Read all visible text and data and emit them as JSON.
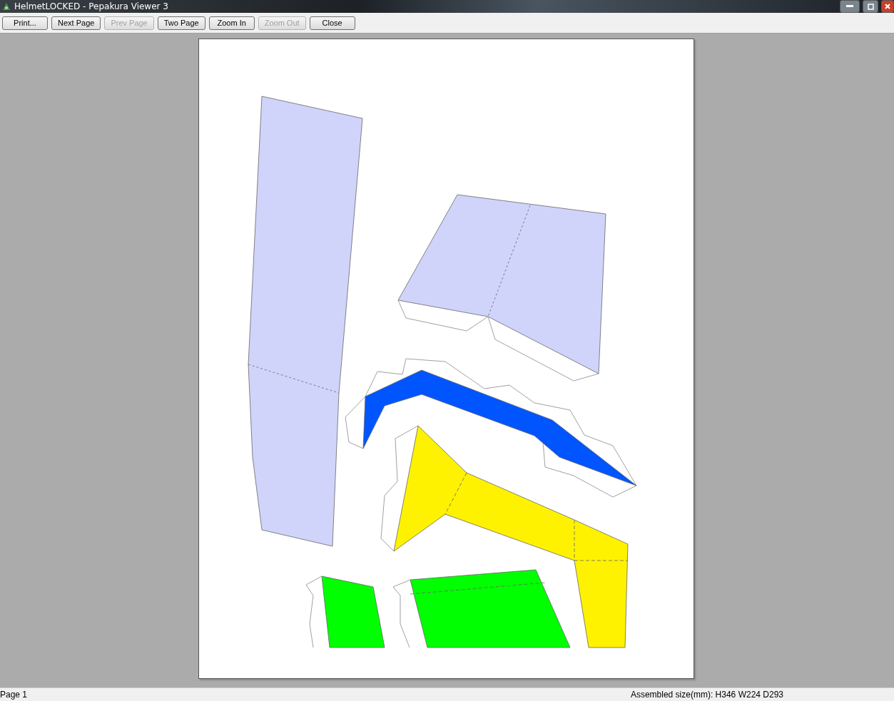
{
  "window": {
    "title": "HelmetLOCKED - Pepakura Viewer 3"
  },
  "toolbar": [
    {
      "label": "Print...",
      "disabled": false
    },
    {
      "label": "Next Page",
      "disabled": false
    },
    {
      "label": "Prev Page",
      "disabled": true
    },
    {
      "label": "Two Page",
      "disabled": false
    },
    {
      "label": "Zoom In",
      "disabled": false
    },
    {
      "label": "Zoom Out",
      "disabled": true
    },
    {
      "label": "Close",
      "disabled": false
    }
  ],
  "status_bar": {
    "page": "Page 1",
    "size": "Assembled size(mm): H346 W224 D293"
  }
}
